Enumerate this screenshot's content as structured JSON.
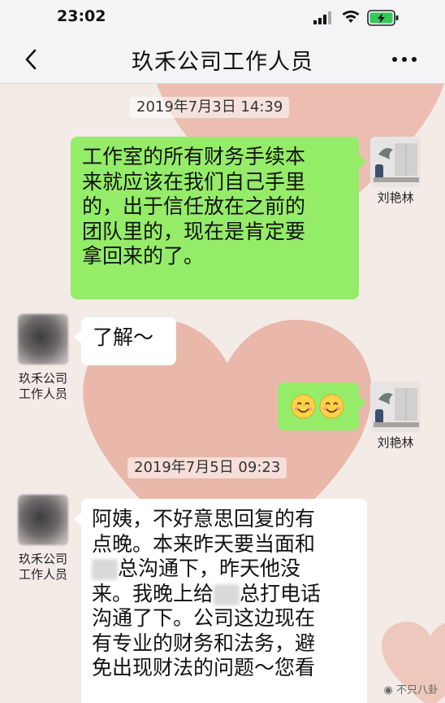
{
  "status_bar": {
    "time": "23:02",
    "icons": [
      "signal-icon",
      "wifi-icon",
      "battery-charging-icon"
    ]
  },
  "nav": {
    "title": "玖禾公司工作人员",
    "back_icon": "chevron-left-icon",
    "more_icon": "more-dots-icon"
  },
  "colors": {
    "self_bubble": "#95ec69",
    "other_bubble": "#ffffff",
    "background": "#f3ebe6",
    "heart": "#e9b2a4"
  },
  "messages": [
    {
      "type": "timestamp",
      "text": "2019年7月3日 14:39"
    },
    {
      "type": "text",
      "from": "self",
      "sender": "刘艳林",
      "lines": [
        "工作室的所有财务手续本",
        "来就应该在我们自己手里",
        "的，出于信任放在之前的",
        "团队里的，现在是肯定要",
        "拿回来的了。"
      ]
    },
    {
      "type": "text",
      "from": "other",
      "sender_lines": [
        "玖禾公司",
        "工作人员"
      ],
      "text": "了解～"
    },
    {
      "type": "emoji",
      "from": "self",
      "sender": "刘艳林",
      "emoji": [
        "smiling-face",
        "smiling-face"
      ]
    },
    {
      "type": "timestamp",
      "text": "2019年7月5日 09:23"
    },
    {
      "type": "text",
      "from": "other",
      "sender_lines": [
        "玖禾公司",
        "工作人员"
      ],
      "lines": [
        "阿姨，不好意思回复的有",
        "点晚。本来昨天要当面和",
        "总沟通下，昨天他没",
        "来。我晚上给",
        "总打电话",
        "沟通了下。公司这边现在",
        "有专业的财务和法务，避",
        "免出现财法的问题～您看"
      ]
    }
  ],
  "watermark": "不只八卦"
}
